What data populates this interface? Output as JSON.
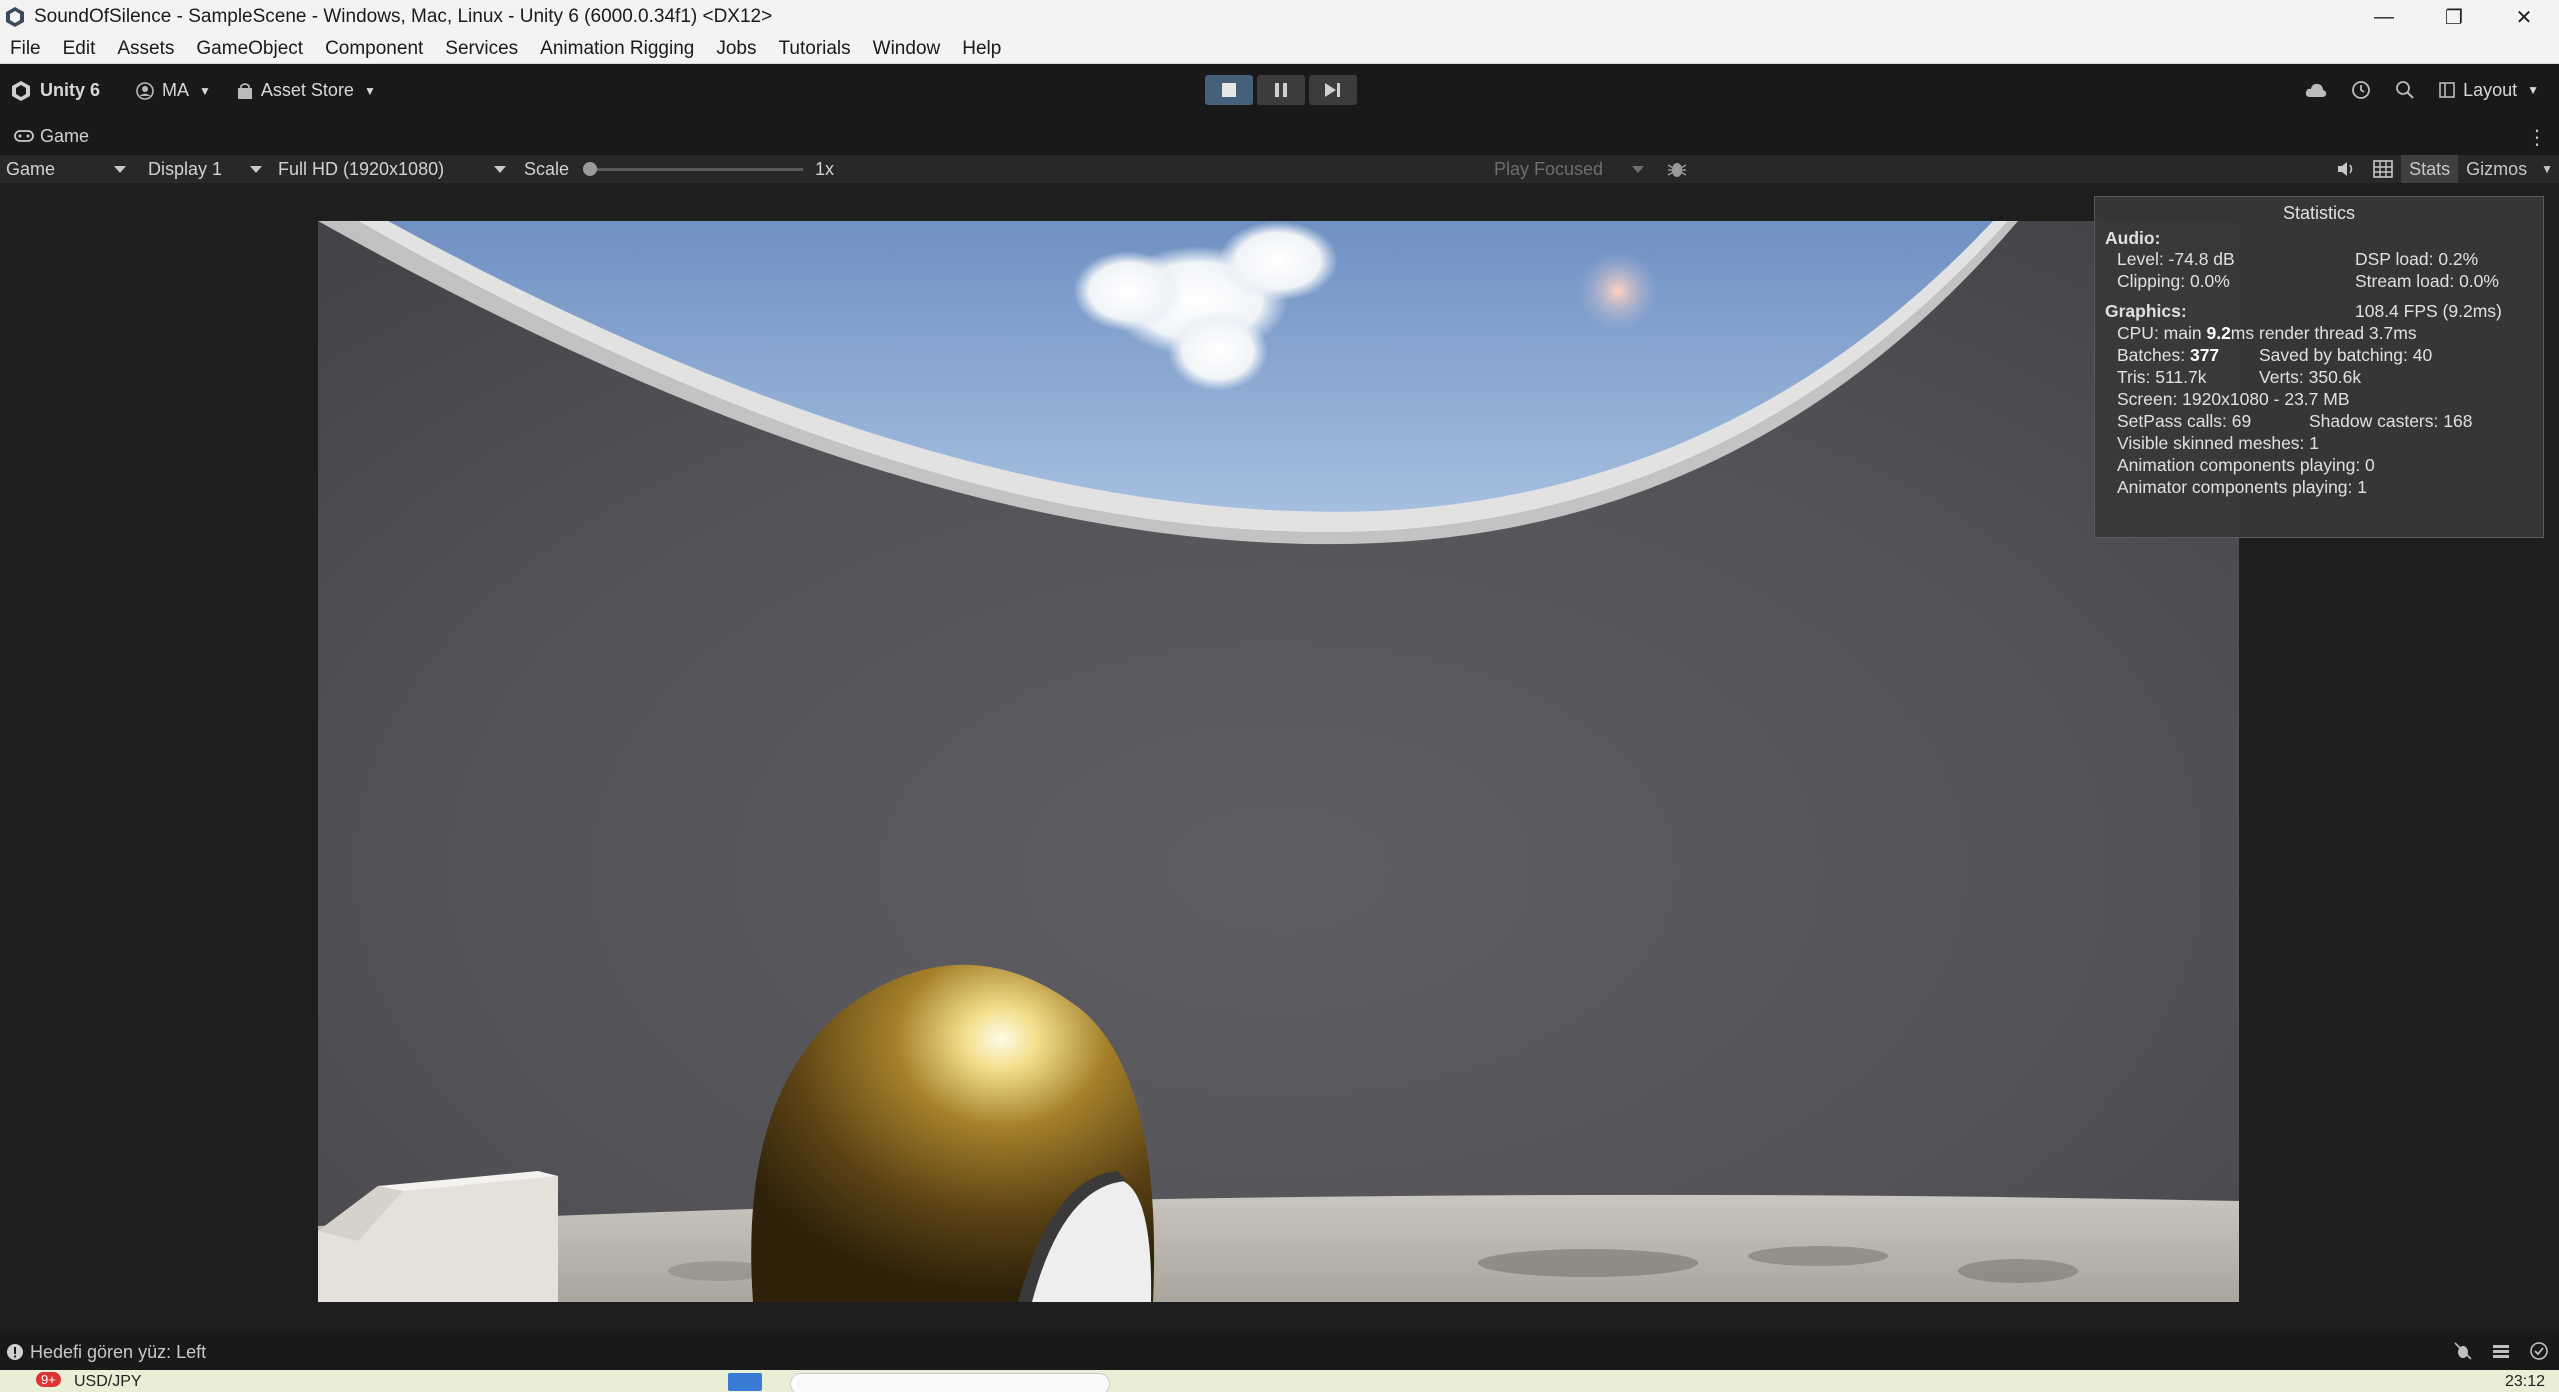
{
  "window": {
    "title": "SoundOfSilence - SampleScene - Windows, Mac, Linux - Unity 6 (6000.0.34f1) <DX12>",
    "controls": [
      "minimize-icon",
      "restore-icon",
      "close-icon"
    ]
  },
  "menu": [
    "File",
    "Edit",
    "Assets",
    "GameObject",
    "Component",
    "Services",
    "Animation Rigging",
    "Jobs",
    "Tutorials",
    "Window",
    "Help"
  ],
  "toolbar": {
    "unity_label": "Unity 6",
    "account_label": "MA",
    "asset_store_label": "Asset Store",
    "layout_label": "Layout",
    "play_state": "playing"
  },
  "game_tab": {
    "label": "Game"
  },
  "game_bar": {
    "view_mode": "Game",
    "display": "Display 1",
    "resolution": "Full HD (1920x1080)",
    "scale_label": "Scale",
    "scale_value": "1x",
    "play_mode": "Play Focused",
    "stats_label": "Stats",
    "gizmos_label": "Gizmos"
  },
  "stats": {
    "title": "Statistics",
    "audio_title": "Audio:",
    "level": "Level: -74.8 dB",
    "dsp_load": "DSP load: 0.2%",
    "clipping": "Clipping: 0.0%",
    "stream_load": "Stream load: 0.0%",
    "graphics_title": "Graphics:",
    "fps": "108.4 FPS (9.2ms)",
    "cpu_prefix": "CPU: main ",
    "cpu_main": "9.2",
    "cpu_suffix": "ms  render thread 3.7ms",
    "batches_prefix": "Batches: ",
    "batches": "377",
    "saved_by_batching": "Saved by batching: 40",
    "tris": "Tris: 511.7k",
    "verts": "Verts: 350.6k",
    "screen": "Screen: 1920x1080 - 23.7 MB",
    "setpass": "SetPass calls: 69",
    "shadow_casters": "Shadow casters: 168",
    "skinned_meshes": "Visible skinned meshes: 1",
    "animation_components": "Animation components playing: 0",
    "animator_components": "Animator components playing: 1"
  },
  "status": {
    "message": "Hedefi gören yüz: Left"
  },
  "taskbar": {
    "badge": "9+",
    "currency": "USD/JPY",
    "time": "23:12"
  }
}
